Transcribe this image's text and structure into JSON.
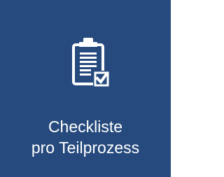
{
  "tile": {
    "label_line1": "Checkliste",
    "label_line2": "pro Teilprozess",
    "icon": "clipboard-checklist-icon",
    "background_color": "#264a7d",
    "foreground_color": "#ffffff"
  }
}
